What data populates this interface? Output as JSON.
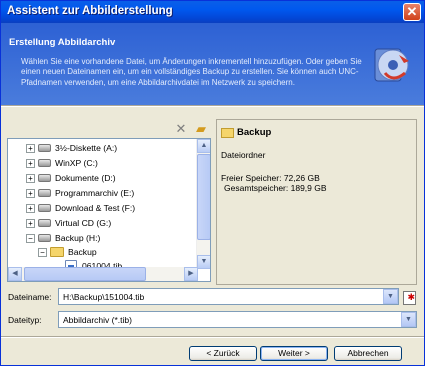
{
  "window": {
    "title": "Assistent zur Abbilderstellung"
  },
  "header": {
    "title": "Erstellung Abbildarchiv",
    "description": "Wählen Sie eine vorhandene Datei, um Änderungen inkrementell hinzuzufügen. Oder geben Sie einen neuen Dateinamen ein, um ein vollständiges Backup zu erstellen. Sie können auch UNC-Pfadnamen verwenden, um eine Abbildarchivdatei im Netzwerk zu speichern."
  },
  "toolbar": {
    "delete_icon": "delete-icon",
    "new_folder_icon": "new-folder-icon"
  },
  "tree": {
    "items": [
      {
        "label": "3½-Diskette (A:)",
        "icon": "floppy-drive-icon",
        "expander": "+"
      },
      {
        "label": "WinXP (C:)",
        "icon": "hard-drive-icon",
        "expander": "+"
      },
      {
        "label": "Dokumente (D:)",
        "icon": "hard-drive-icon",
        "expander": "+"
      },
      {
        "label": "Programmarchiv (E:)",
        "icon": "hard-drive-icon",
        "expander": "+"
      },
      {
        "label": "Download & Test (F:)",
        "icon": "hard-drive-icon",
        "expander": "+"
      },
      {
        "label": "Virtual CD (G:)",
        "icon": "cd-drive-icon",
        "expander": "+"
      },
      {
        "label": "Backup (H:)",
        "icon": "hard-drive-icon",
        "expander": "−"
      },
      {
        "label": "Backup",
        "icon": "folder-icon",
        "expander": "−"
      },
      {
        "label": "061004.tib",
        "icon": "archive-file-icon",
        "expander": ""
      }
    ]
  },
  "info": {
    "title": "Backup",
    "type": "Dateiordner",
    "free": "Freier Speicher: 72,26 GB",
    "total": "Gesamtspeicher: 189,9 GB"
  },
  "form": {
    "filename_label": "Dateiname:",
    "filename_value": "H:\\Backup\\151004.tib",
    "filetype_label": "Dateityp:",
    "filetype_value": "Abbildarchiv (*.tib)"
  },
  "buttons": {
    "back": "< Zurück",
    "next": "Weiter >",
    "cancel": "Abbrechen"
  },
  "colors": {
    "title_bar": "#0058EE",
    "header_bg": "#2D61D4",
    "window_bg": "#ECE9D8"
  }
}
